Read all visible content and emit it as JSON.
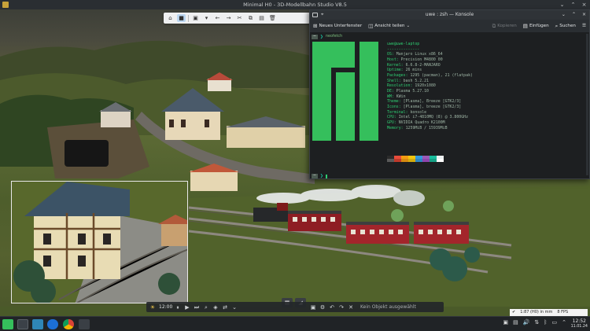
{
  "window": {
    "title": "Minimal H0 - 3D-Modellbahn Studio V8.5"
  },
  "toolbar": {
    "icons": [
      "home-icon",
      "lock-icon",
      "save-icon",
      "dropdown-icon",
      "undo-icon",
      "redo-icon",
      "cut-icon",
      "copy-icon",
      "paste-icon",
      "delete-icon"
    ]
  },
  "hud": {
    "time": "12:00",
    "status_text": "Kein Objekt ausgewählt",
    "icons": [
      "sun-icon",
      "pause-icon",
      "play-icon",
      "fast-forward-icon",
      "search-icon",
      "layers-icon",
      "shuffle-icon",
      "chevron-down-icon",
      "save-icon",
      "settings-icon",
      "undo-icon",
      "redo-icon",
      "close-icon"
    ]
  },
  "statusbox": {
    "scale": "1:87 (H0) in mm",
    "fps": "8 FPS"
  },
  "konsole": {
    "title": "uwe : zsh — Konsole",
    "toolbar": {
      "new_tab": "Neues Unterfenster",
      "split": "Ansicht teilen",
      "copy": "Kopieren",
      "paste": "Einfügen",
      "search": "Suchen"
    },
    "prompt_user": "~",
    "command": "neofetch",
    "header": "uwe@uwe-laptop",
    "separator": "--------------",
    "fields": [
      {
        "key": "OS",
        "value": "Manjaro Linux x86_64"
      },
      {
        "key": "Host",
        "value": "Precision M4800 00"
      },
      {
        "key": "Kernel",
        "value": "6.6.8-2-MANJARO"
      },
      {
        "key": "Uptime",
        "value": "26 mins"
      },
      {
        "key": "Packages",
        "value": "1295 (pacman), 21 (flatpak)"
      },
      {
        "key": "Shell",
        "value": "bash 5.2.21"
      },
      {
        "key": "Resolution",
        "value": "1920x1080"
      },
      {
        "key": "DE",
        "value": "Plasma 5.27.10"
      },
      {
        "key": "WM",
        "value": "KWin"
      },
      {
        "key": "Theme",
        "value": "[Plasma], Breeze [GTK2/3]"
      },
      {
        "key": "Icons",
        "value": "[Plasma], breeze [GTK2/3]"
      },
      {
        "key": "Terminal",
        "value": "konsole"
      },
      {
        "key": "CPU",
        "value": "Intel i7-4810MQ (8) @ 3.800GHz"
      },
      {
        "key": "GPU",
        "value": "NVIDIA Quadro K2100M"
      },
      {
        "key": "Memory",
        "value": "1259MiB / 15939MiB"
      }
    ],
    "palette_row1": [
      "#2b2b2b",
      "#e74c3c",
      "#f39c12",
      "#f1c40f",
      "#3498db",
      "#9b59b6",
      "#1abc9c",
      "#ecf0f1"
    ],
    "palette_row2": [
      "#5a5a5a",
      "#c0392b",
      "#d68910",
      "#d4ac0d",
      "#2e86c1",
      "#8e44ad",
      "#16a085",
      "#ffffff"
    ]
  },
  "taskbar": {
    "apps": [
      "manjaro-menu-icon",
      "modellbahn-studio-icon",
      "file-manager-icon",
      "browser-blue-icon",
      "chrome-icon",
      "train-icon"
    ],
    "clock_time": "12:52",
    "clock_date": "11.01.24"
  },
  "colors": {
    "manjaro_green": "#35bf5c",
    "terminal_text": "#2ecc71"
  }
}
